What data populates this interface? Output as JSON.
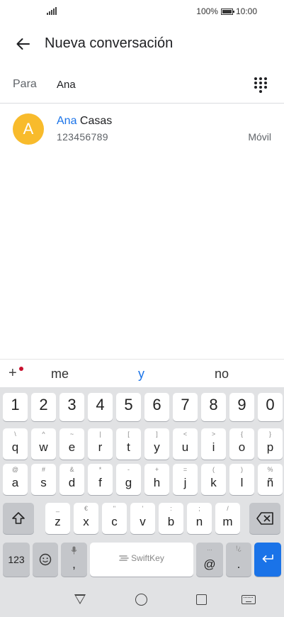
{
  "status_bar": {
    "battery_percent": "100%",
    "time": "10:00",
    "icons": [
      "signal-icon",
      "battery-icon"
    ]
  },
  "app_bar": {
    "back_icon": "arrow-left-icon",
    "title": "Nueva conversación"
  },
  "recipient": {
    "label": "Para",
    "value": "Ana",
    "dialpad_icon": "dialpad-icon"
  },
  "contact": {
    "avatar_letter": "A",
    "avatar_color": "#f8bb2c",
    "name_match": "Ana",
    "name_rest": " Casas",
    "phone": "123456789",
    "phone_type": "Móvil",
    "highlight_color": "#1a73e8"
  },
  "suggestions": {
    "plus": "+",
    "items": [
      "me",
      "y",
      "no"
    ]
  },
  "keyboard": {
    "numbers": [
      "1",
      "2",
      "3",
      "4",
      "5",
      "6",
      "7",
      "8",
      "9",
      "0"
    ],
    "row1": [
      {
        "main": "q",
        "sec": "\\"
      },
      {
        "main": "w",
        "sec": "^"
      },
      {
        "main": "e",
        "sec": "~"
      },
      {
        "main": "r",
        "sec": "|"
      },
      {
        "main": "t",
        "sec": "["
      },
      {
        "main": "y",
        "sec": "]"
      },
      {
        "main": "u",
        "sec": "<"
      },
      {
        "main": "i",
        "sec": ">"
      },
      {
        "main": "o",
        "sec": "{"
      },
      {
        "main": "p",
        "sec": "}"
      }
    ],
    "row2": [
      {
        "main": "a",
        "sec": "@"
      },
      {
        "main": "s",
        "sec": "#"
      },
      {
        "main": "d",
        "sec": "&"
      },
      {
        "main": "f",
        "sec": "*"
      },
      {
        "main": "g",
        "sec": "-"
      },
      {
        "main": "h",
        "sec": "+"
      },
      {
        "main": "j",
        "sec": "="
      },
      {
        "main": "k",
        "sec": "("
      },
      {
        "main": "l",
        "sec": ")"
      },
      {
        "main": "ñ",
        "sec": "%"
      }
    ],
    "row3": [
      {
        "main": "z",
        "sec": "_"
      },
      {
        "main": "x",
        "sec": "€"
      },
      {
        "main": "c",
        "sec": "\""
      },
      {
        "main": "v",
        "sec": "'"
      },
      {
        "main": "b",
        "sec": ":"
      },
      {
        "main": "n",
        "sec": ";"
      },
      {
        "main": "m",
        "sec": "/"
      }
    ],
    "shift_icon": "shift-icon",
    "backspace_icon": "backspace-icon",
    "symbols_label": "123",
    "emoji_icon": "emoji-icon",
    "mic_comma": {
      "main": ",",
      "sec_icon": "microphone-icon"
    },
    "space_label": "SwiftKey",
    "at_key": {
      "main": "@",
      "sec": "..."
    },
    "dot_key": {
      "main": ".",
      "sec": "!¿"
    },
    "enter_icon": "enter-icon",
    "enter_color": "#1a73e8"
  },
  "nav_bar": {
    "icons": [
      "back-triangle-icon",
      "home-circle-icon",
      "recents-square-icon",
      "keyboard-icon"
    ]
  }
}
